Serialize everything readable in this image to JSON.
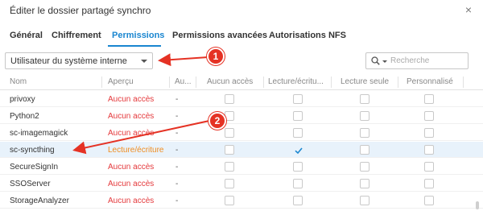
{
  "window": {
    "title": "Éditer le dossier partagé synchro",
    "close_glyph": "×"
  },
  "tabs": [
    {
      "label": "Général",
      "active": false
    },
    {
      "label": "Chiffrement",
      "active": false
    },
    {
      "label": "Permissions",
      "active": true
    },
    {
      "label": "Permissions avancées",
      "active": false
    },
    {
      "label": "Autorisations NFS",
      "active": false
    }
  ],
  "toolbar": {
    "user_type_selected": "Utilisateur du système interne",
    "search_placeholder": "Recherche",
    "search_icon": "search-icon"
  },
  "table": {
    "columns": [
      "Nom",
      "Aperçu",
      "Au...",
      "Aucun accès",
      "Lecture/écritu...",
      "Lecture seule",
      "Personnalisé"
    ],
    "rows": [
      {
        "name": "privoxy",
        "apercu": "Aucun accès",
        "au": "-",
        "aucun": false,
        "rw": false,
        "ro": false,
        "custom": false,
        "selected": false
      },
      {
        "name": "Python2",
        "apercu": "Aucun accès",
        "au": "-",
        "aucun": false,
        "rw": false,
        "ro": false,
        "custom": false,
        "selected": false
      },
      {
        "name": "sc-imagemagick",
        "apercu": "Aucun accès",
        "au": "-",
        "aucun": false,
        "rw": false,
        "ro": false,
        "custom": false,
        "selected": false
      },
      {
        "name": "sc-syncthing",
        "apercu": "Lecture/écriture",
        "au": "-",
        "aucun": false,
        "rw": true,
        "ro": false,
        "custom": false,
        "selected": true
      },
      {
        "name": "SecureSignIn",
        "apercu": "Aucun accès",
        "au": "-",
        "aucun": false,
        "rw": false,
        "ro": false,
        "custom": false,
        "selected": false
      },
      {
        "name": "SSOServer",
        "apercu": "Aucun accès",
        "au": "-",
        "aucun": false,
        "rw": false,
        "ro": false,
        "custom": false,
        "selected": false
      },
      {
        "name": "StorageAnalyzer",
        "apercu": "Aucun accès",
        "au": "-",
        "aucun": false,
        "rw": false,
        "ro": false,
        "custom": false,
        "selected": false
      }
    ]
  },
  "annotations": [
    {
      "label": "1"
    },
    {
      "label": "2"
    }
  ],
  "colors": {
    "accent": "#1a86d0",
    "no_access": "#e4393c",
    "read_write": "#f08c1f",
    "callout": "#e53224",
    "selected_row": "#e8f2fb"
  }
}
